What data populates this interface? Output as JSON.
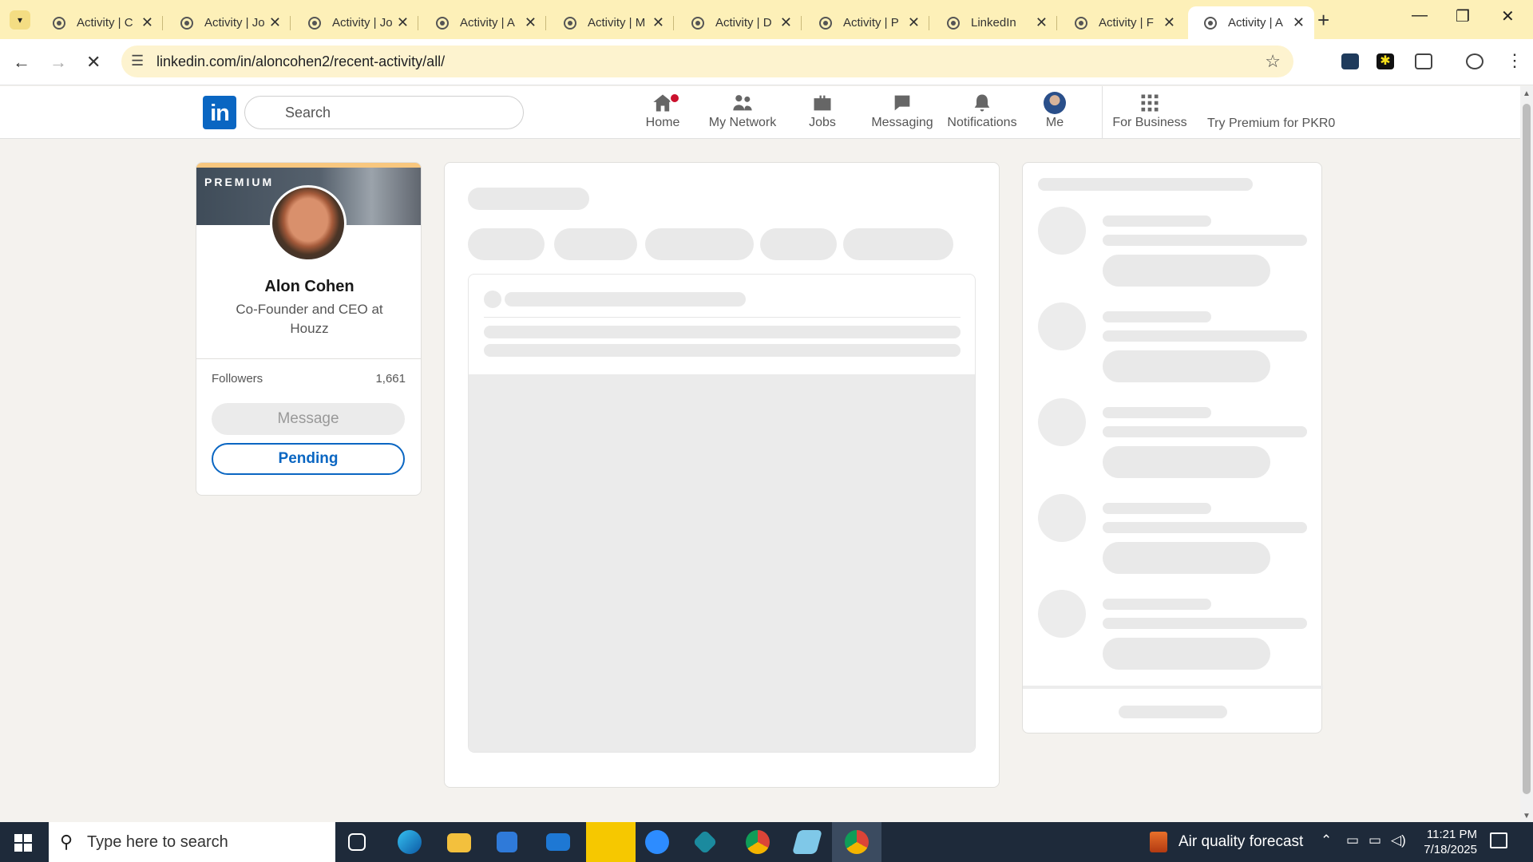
{
  "browser": {
    "tabs": [
      {
        "title": "Activity | C"
      },
      {
        "title": "Activity | Jo"
      },
      {
        "title": "Activity | Jo"
      },
      {
        "title": "Activity | A"
      },
      {
        "title": "Activity | M"
      },
      {
        "title": "Activity | D"
      },
      {
        "title": "Activity | P"
      },
      {
        "title": "LinkedIn"
      },
      {
        "title": "Activity | F"
      },
      {
        "title": "Activity | A"
      }
    ],
    "active_tab_index": 9,
    "url": "linkedin.com/in/aloncohen2/recent-activity/all/",
    "loading": true,
    "accent_color": "#fdf0b8"
  },
  "linkedin": {
    "brand_color": "#0a66c2",
    "logo_text": "in",
    "search_placeholder": "Search",
    "nav": {
      "home": "Home",
      "network": "My Network",
      "jobs": "Jobs",
      "messaging": "Messaging",
      "notifications": "Notifications",
      "me": "Me",
      "business": "For Business",
      "premium": "Try Premium for PKR0"
    },
    "home_has_notification": true
  },
  "profile": {
    "tag": "PREMIUM",
    "name": "Alon Cohen",
    "headline": "Co-Founder and CEO at Houzz",
    "followers_label": "Followers",
    "followers_count": "1,661",
    "message_button": "Message",
    "pending_button": "Pending"
  },
  "taskbar": {
    "search_placeholder": "Type here to search",
    "weather_text": "Air quality forecast",
    "time": "11:21 PM",
    "date": "7/18/2025"
  }
}
